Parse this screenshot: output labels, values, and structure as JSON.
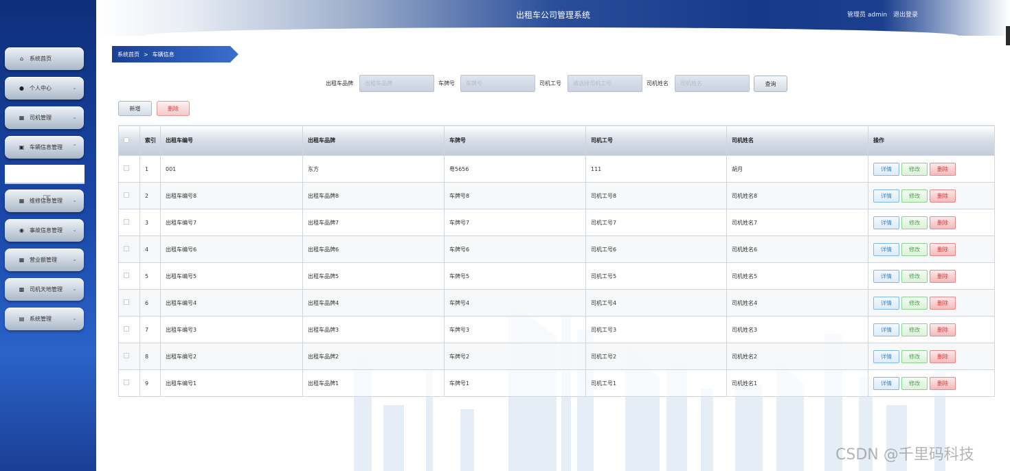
{
  "header": {
    "title": "出租车公司管理系统",
    "user_label": "管理员 admin",
    "logout_label": "退出登录"
  },
  "sidebar": {
    "items": [
      {
        "label": "系统首页",
        "icon": "home-icon"
      },
      {
        "label": "个人中心",
        "icon": "person-icon"
      },
      {
        "label": "司机管理",
        "icon": "grid-icon"
      },
      {
        "label": "车辆信息管理",
        "icon": "monitor-icon"
      },
      {
        "label": "维修信息管理",
        "icon": "grid-icon"
      },
      {
        "label": "事故信息管理",
        "icon": "pin-icon"
      },
      {
        "label": "营业额管理",
        "icon": "grid-icon"
      },
      {
        "label": "司机天地管理",
        "icon": "board-icon"
      },
      {
        "label": "系统管理",
        "icon": "briefcase-icon"
      }
    ]
  },
  "breadcrumb": {
    "home": "系统首页",
    "separator": ">",
    "current": "车辆信息"
  },
  "search": {
    "brand_label": "出租车品牌",
    "brand_placeholder": "出租车品牌",
    "plate_label": "车牌号",
    "plate_placeholder": "车牌号",
    "driver_id_label": "司机工号",
    "driver_id_placeholder": "请选择司机工号",
    "driver_name_label": "司机姓名",
    "driver_name_placeholder": "司机姓名",
    "query_label": "查询"
  },
  "actions": {
    "add_label": "新增",
    "delete_label": "删除"
  },
  "table": {
    "headers": [
      "索引",
      "出租车编号",
      "出租车品牌",
      "车牌号",
      "司机工号",
      "司机姓名",
      "操作"
    ],
    "rows": [
      {
        "idx": "1",
        "no": "001",
        "brand": "东方",
        "plate": "粤5656",
        "driver_id": "111",
        "driver_name": "胡月"
      },
      {
        "idx": "2",
        "no": "出租车编号8",
        "brand": "出租车品牌8",
        "plate": "车牌号8",
        "driver_id": "司机工号8",
        "driver_name": "司机姓名8"
      },
      {
        "idx": "3",
        "no": "出租车编号7",
        "brand": "出租车品牌7",
        "plate": "车牌号7",
        "driver_id": "司机工号7",
        "driver_name": "司机姓名7"
      },
      {
        "idx": "4",
        "no": "出租车编号6",
        "brand": "出租车品牌6",
        "plate": "车牌号6",
        "driver_id": "司机工号6",
        "driver_name": "司机姓名6"
      },
      {
        "idx": "5",
        "no": "出租车编号5",
        "brand": "出租车品牌5",
        "plate": "车牌号5",
        "driver_id": "司机工号5",
        "driver_name": "司机姓名5"
      },
      {
        "idx": "6",
        "no": "出租车编号4",
        "brand": "出租车品牌4",
        "plate": "车牌号4",
        "driver_id": "司机工号4",
        "driver_name": "司机姓名4"
      },
      {
        "idx": "7",
        "no": "出租车编号3",
        "brand": "出租车品牌3",
        "plate": "车牌号3",
        "driver_id": "司机工号3",
        "driver_name": "司机姓名3"
      },
      {
        "idx": "8",
        "no": "出租车编号2",
        "brand": "出租车品牌2",
        "plate": "车牌号2",
        "driver_id": "司机工号2",
        "driver_name": "司机姓名2"
      },
      {
        "idx": "9",
        "no": "出租车编号1",
        "brand": "出租车品牌1",
        "plate": "车牌号1",
        "driver_id": "司机工号1",
        "driver_name": "司机姓名1"
      }
    ],
    "op_labels": {
      "detail": "详情",
      "edit": "修改",
      "delete": "删除"
    }
  },
  "watermark": "CSDN @千里码科技",
  "colors": {
    "sidebar": "#1a47a8",
    "header_dark": "#163a88",
    "breadcrumb": "#1a3f93",
    "detail_btn": "#3a86d0",
    "edit_btn": "#4aa34a",
    "delete_btn": "#c83c3c"
  }
}
